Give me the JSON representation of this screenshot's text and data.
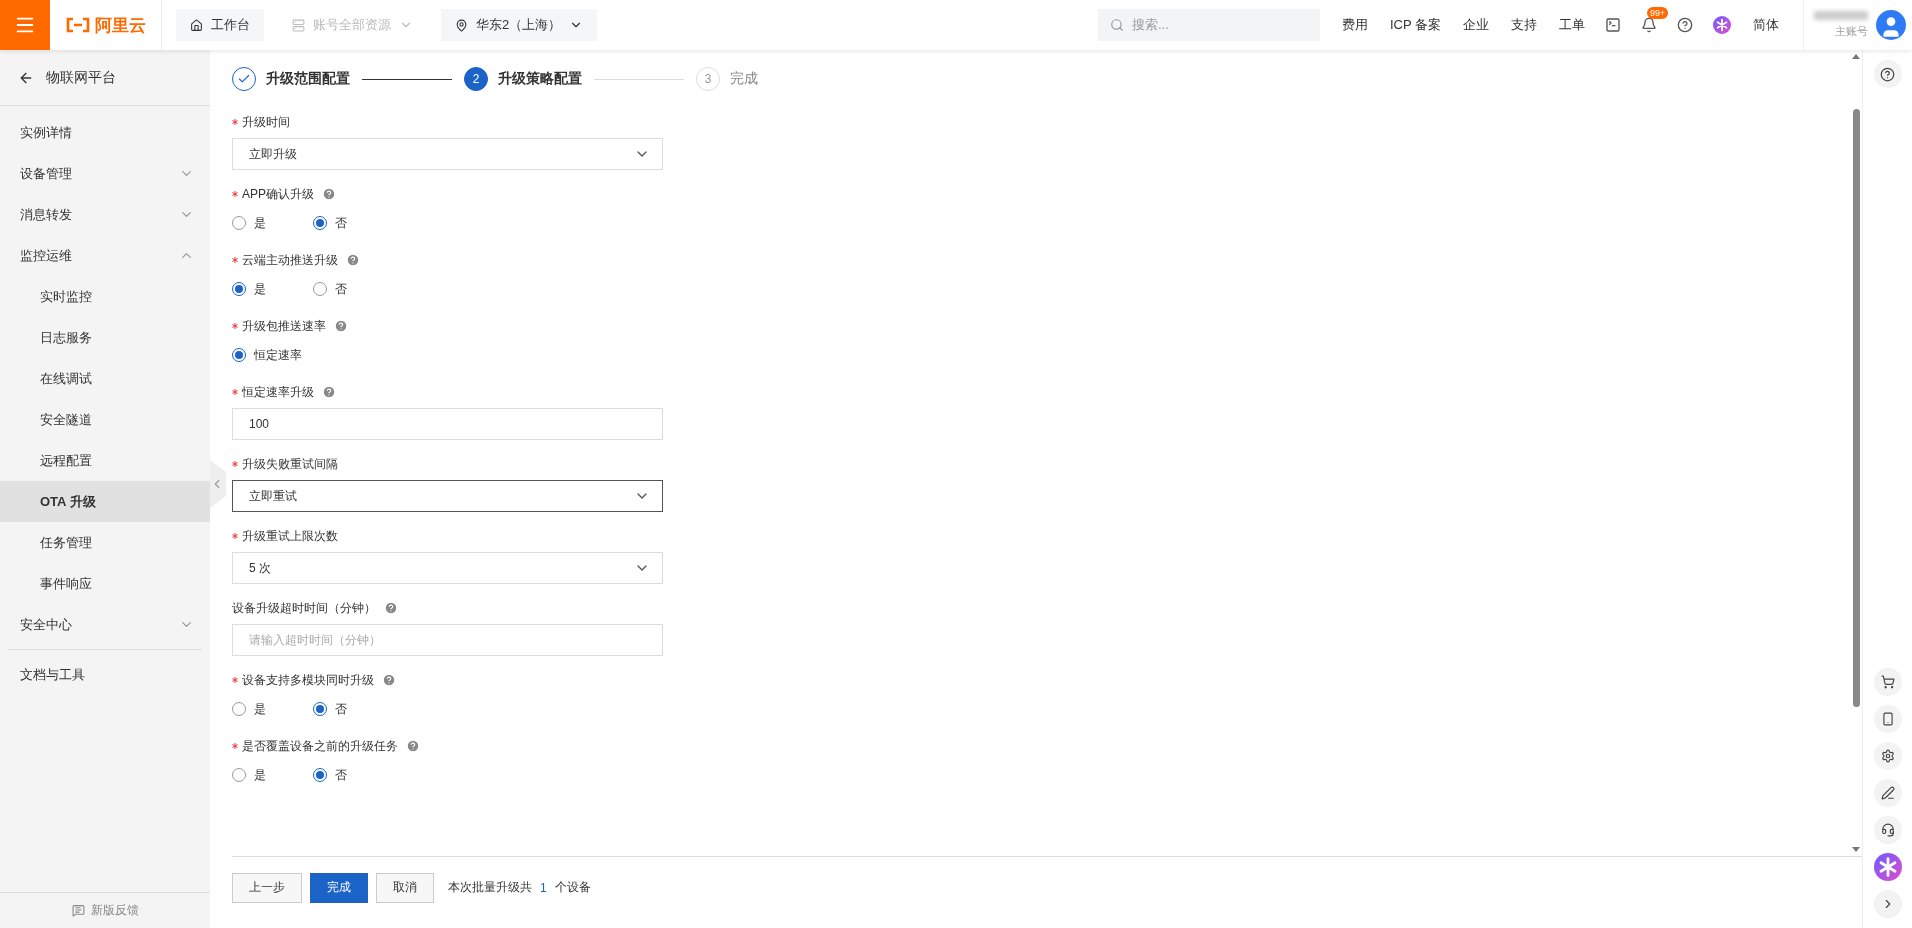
{
  "topbar": {
    "logo": "阿里云",
    "nav": [
      {
        "kind": "home",
        "label": "工作台",
        "disabled": false
      },
      {
        "kind": "resource",
        "label": "账号全部资源",
        "disabled": true
      },
      {
        "kind": "region",
        "label": "华东2（上海）",
        "disabled": false
      }
    ],
    "search": {
      "placeholder": "搜索..."
    },
    "links": [
      "费用",
      "ICP 备案",
      "企业",
      "支持",
      "工单"
    ],
    "badge": "99+",
    "language": "简体",
    "account": "主账号"
  },
  "sidebar": {
    "back": "物联网平台",
    "items": [
      {
        "label": "实例详情",
        "selected": false
      },
      {
        "label": "设备管理",
        "selected": false,
        "expanded": false
      },
      {
        "label": "消息转发",
        "selected": false,
        "expanded": false
      },
      {
        "label": "监控运维",
        "selected": false,
        "expanded": true,
        "children": [
          {
            "label": "实时监控",
            "selected": false
          },
          {
            "label": "日志服务",
            "selected": false
          },
          {
            "label": "在线调试",
            "selected": false
          },
          {
            "label": "安全隧道",
            "selected": false
          },
          {
            "label": "远程配置",
            "selected": false
          },
          {
            "label": "OTA 升级",
            "selected": true
          },
          {
            "label": "任务管理",
            "selected": false
          },
          {
            "label": "事件响应",
            "selected": false
          }
        ]
      },
      {
        "label": "安全中心",
        "selected": false,
        "expanded": false
      }
    ],
    "bottom_items": [
      {
        "label": "文档与工具",
        "selected": false
      }
    ],
    "feedback": "新版反馈"
  },
  "steps": [
    {
      "label": "升级范围配置",
      "completed": true,
      "selected": false
    },
    {
      "number": "2",
      "label": "升级策略配置",
      "completed": false,
      "selected": true
    },
    {
      "number": "3",
      "label": "完成",
      "completed": false,
      "selected": false
    }
  ],
  "form": [
    {
      "kind": "select",
      "label": "升级时间",
      "required": true,
      "help": false,
      "value": "立即升级",
      "focused": false
    },
    {
      "kind": "radio",
      "label": "APP确认升级",
      "required": true,
      "help": true,
      "options": [
        {
          "label": "是",
          "selected": false
        },
        {
          "label": "否",
          "selected": true
        }
      ]
    },
    {
      "kind": "radio",
      "label": "云端主动推送升级",
      "required": true,
      "help": true,
      "options": [
        {
          "label": "是",
          "selected": true
        },
        {
          "label": "否",
          "selected": false
        }
      ]
    },
    {
      "kind": "radio",
      "label": "升级包推送速率",
      "required": true,
      "help": true,
      "options": [
        {
          "label": "恒定速率",
          "selected": true
        }
      ]
    },
    {
      "kind": "input",
      "label": "恒定速率升级",
      "required": true,
      "help": true,
      "value": "100"
    },
    {
      "kind": "select",
      "label": "升级失败重试间隔",
      "required": true,
      "help": false,
      "value": "立即重试",
      "focused": true
    },
    {
      "kind": "select",
      "label": "升级重试上限次数",
      "required": true,
      "help": false,
      "value": "5 次",
      "focused": false
    },
    {
      "kind": "input",
      "label": "设备升级超时时间（分钟）",
      "required": false,
      "help": true,
      "placeholder": "请输入超时时间（分钟）"
    },
    {
      "kind": "radio",
      "label": "设备支持多模块同时升级",
      "required": true,
      "help": true,
      "options": [
        {
          "label": "是",
          "selected": false
        },
        {
          "label": "否",
          "selected": true
        }
      ]
    },
    {
      "kind": "radio",
      "label": "是否覆盖设备之前的升级任务",
      "required": true,
      "help": true,
      "options": [
        {
          "label": "是",
          "selected": false
        },
        {
          "label": "否",
          "selected": true
        }
      ]
    }
  ],
  "footer": {
    "buttons": [
      {
        "kind": "default",
        "label": "上一步"
      },
      {
        "kind": "primary",
        "label": "完成"
      },
      {
        "kind": "default",
        "label": "取消"
      }
    ],
    "summary": {
      "prefix": "本次批量升级共",
      "count": "1",
      "suffix": "个设备"
    }
  }
}
